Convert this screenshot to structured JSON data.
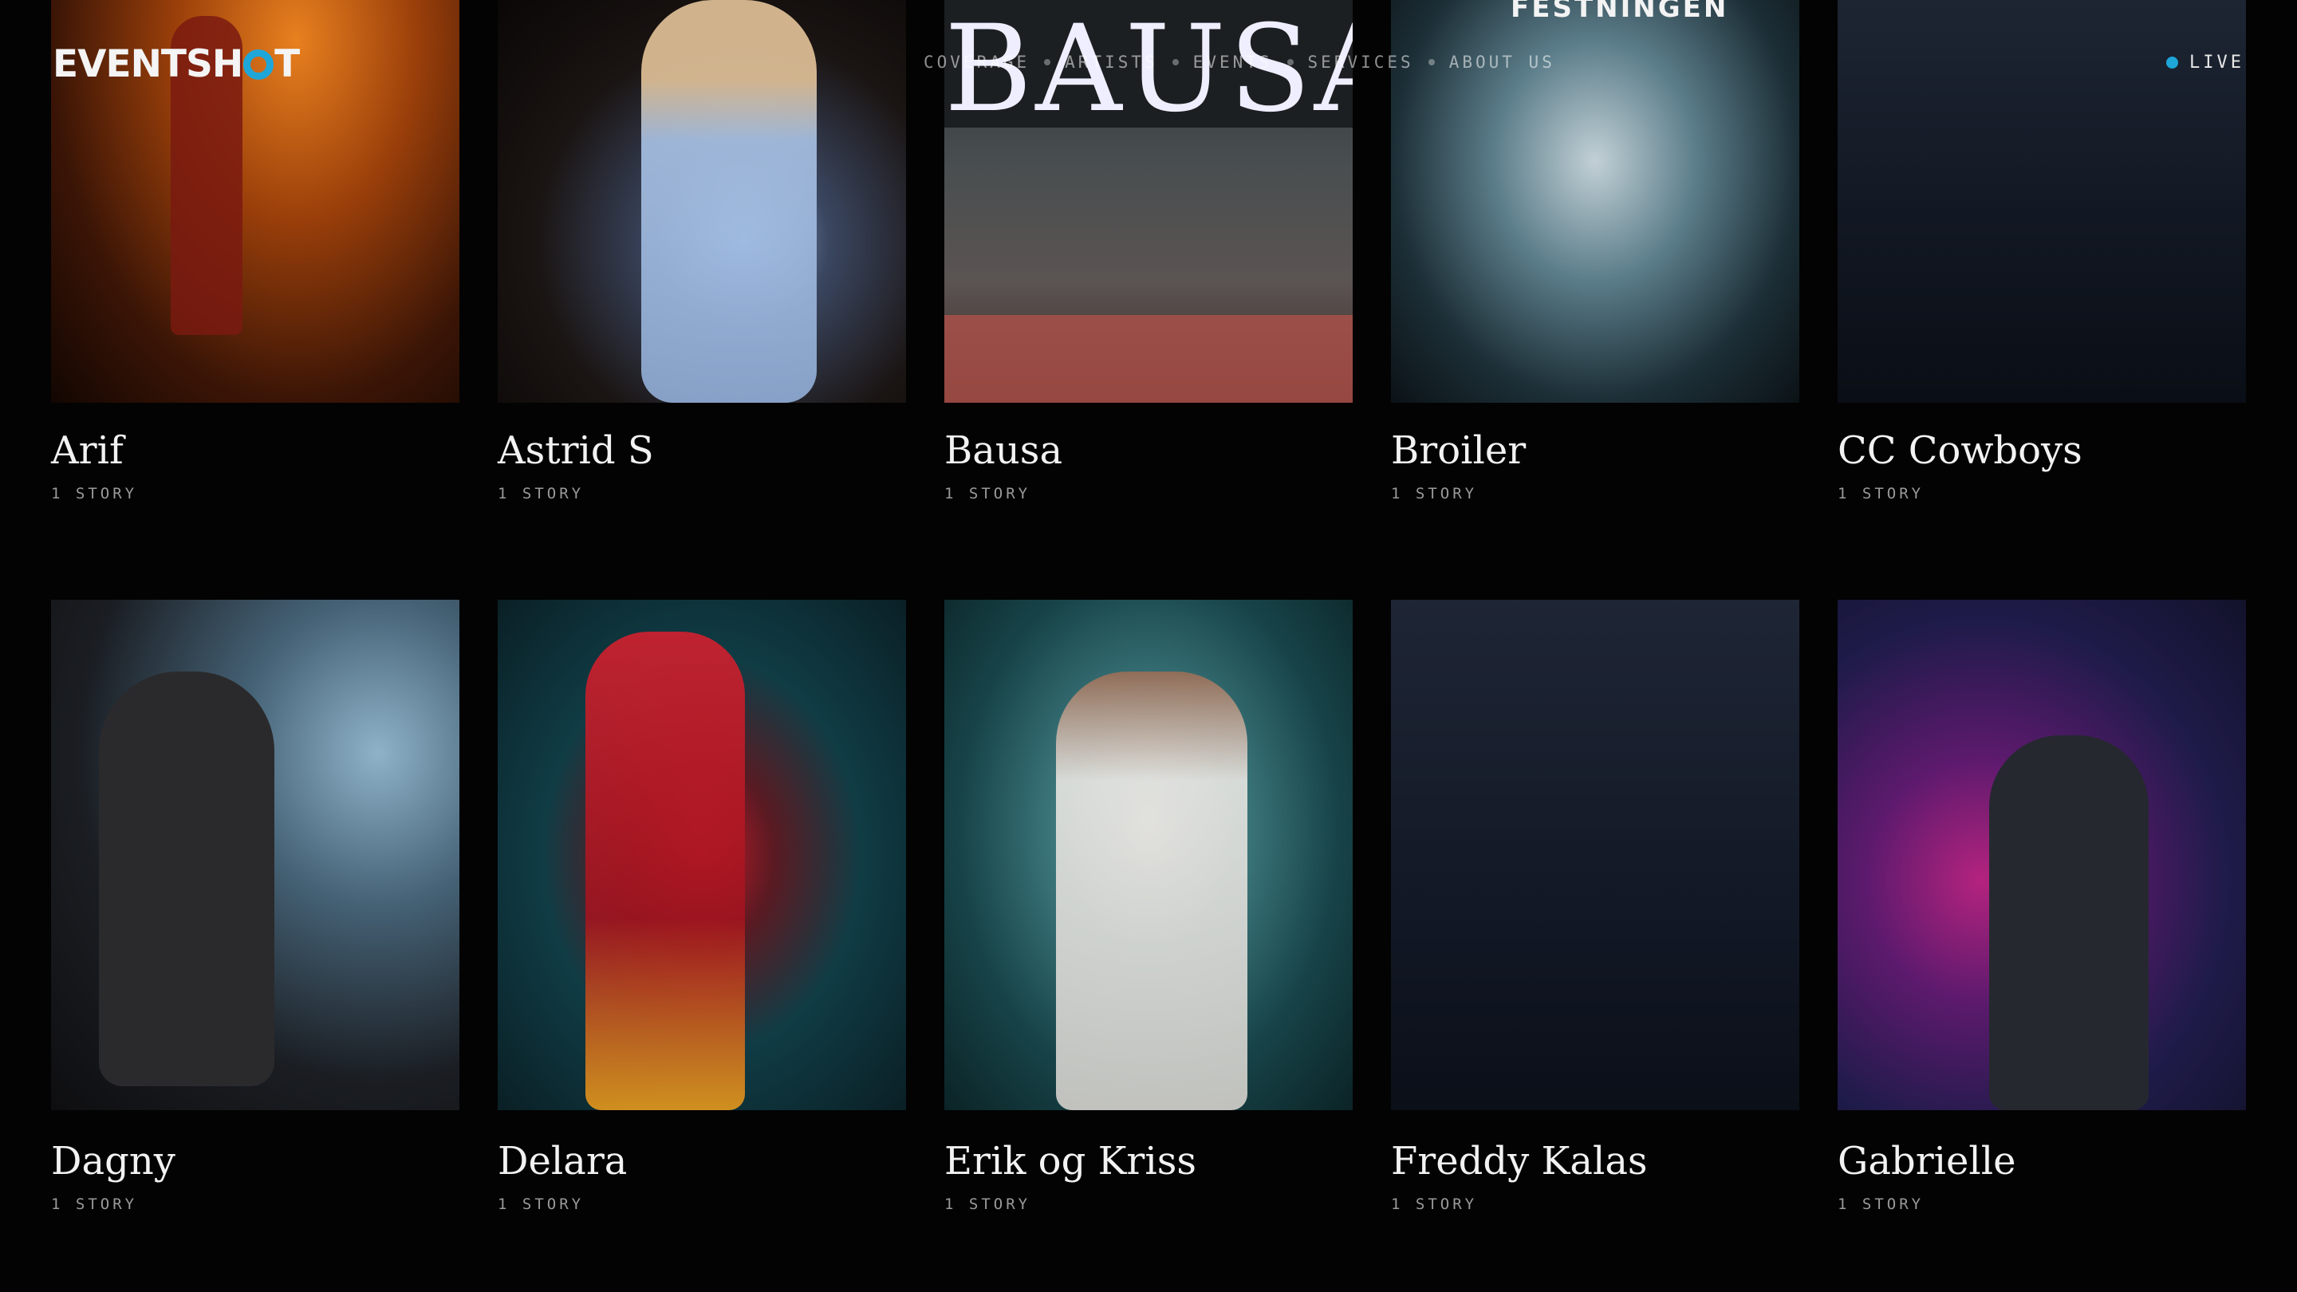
{
  "header": {
    "logo": {
      "before": "EVENTSH",
      "after": "T",
      "mark_color": "#1fa6d8"
    },
    "nav": [
      {
        "label": "COVERAGE"
      },
      {
        "label": "ARTISTS"
      },
      {
        "label": "EVENTS"
      },
      {
        "label": "SERVICES"
      },
      {
        "label": "ABOUT US"
      }
    ],
    "status": {
      "label": "LIVE",
      "dot_color": "#1fa6d8"
    }
  },
  "artists": [
    {
      "name": "Arif",
      "count": "1 STORY"
    },
    {
      "name": "Astrid S",
      "count": "1 STORY"
    },
    {
      "name": "Bausa",
      "count": "1 STORY",
      "photo_text": "BAUSA"
    },
    {
      "name": "Broiler",
      "count": "1 STORY",
      "photo_text": "FESTNINGEN"
    },
    {
      "name": "CC Cowboys",
      "count": "1 STORY"
    },
    {
      "name": "Dagny",
      "count": "1 STORY"
    },
    {
      "name": "Delara",
      "count": "1 STORY"
    },
    {
      "name": "Erik og Kriss",
      "count": "1 STORY"
    },
    {
      "name": "Freddy Kalas",
      "count": "1 STORY"
    },
    {
      "name": "Gabrielle",
      "count": "1 STORY"
    }
  ]
}
